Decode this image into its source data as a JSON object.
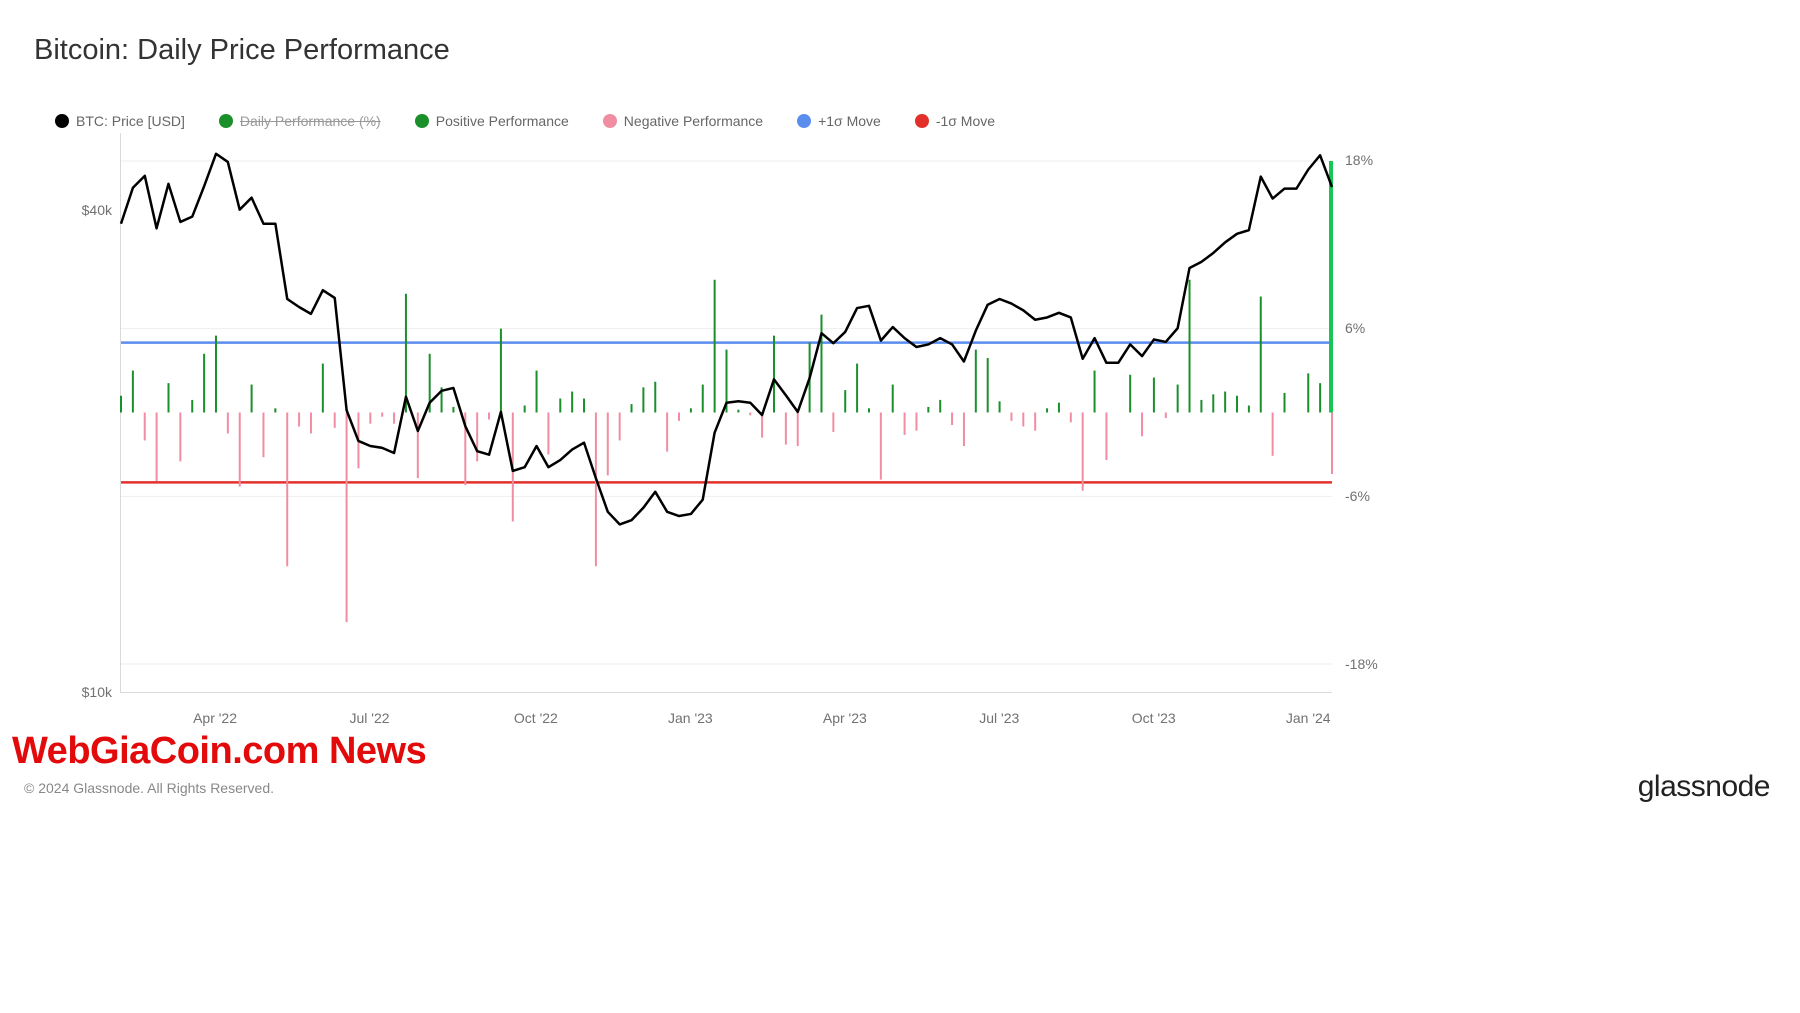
{
  "title": "Bitcoin: Daily Price Performance",
  "legend": [
    {
      "key": "price",
      "label": "BTC: Price [USD]",
      "color": "#000000",
      "hidden": false
    },
    {
      "key": "daily_pct",
      "label": "Daily Performance (%)",
      "color": "#1a8f2a",
      "hidden": true
    },
    {
      "key": "pos_perf",
      "label": "Positive Performance",
      "color": "#1a8f2a",
      "hidden": false
    },
    {
      "key": "neg_perf",
      "label": "Negative Performance",
      "color": "#f08da2",
      "hidden": false
    },
    {
      "key": "plus1s",
      "label": "+1σ Move",
      "color": "#5b8def",
      "hidden": false
    },
    {
      "key": "minus1s",
      "label": "-1σ Move",
      "color": "#e2302a",
      "hidden": false
    }
  ],
  "watermark": "WebGiaCoin.com News",
  "copyright": "© 2024 Glassnode. All Rights Reserved.",
  "brand": "glassnode",
  "chart_data": {
    "type": "line+bar",
    "title": "Bitcoin: Daily Price Performance",
    "x_ticks": [
      "Apr '22",
      "Jul '22",
      "Oct '22",
      "Jan '23",
      "Apr '23",
      "Jul '23",
      "Oct '23",
      "Jan '24"
    ],
    "y1": {
      "label": "",
      "ticks": [
        "$40k",
        "$10k"
      ],
      "scale": "log",
      "range": [
        10000,
        50000
      ]
    },
    "y2": {
      "label": "",
      "ticks": [
        "18%",
        "6%",
        "-6%",
        "-18%"
      ],
      "range": [
        -20,
        20
      ]
    },
    "sigma_plus": 5.0,
    "sigma_minus": -5.0,
    "dates": [
      "2022-02-01",
      "2022-02-08",
      "2022-02-15",
      "2022-02-22",
      "2022-03-01",
      "2022-03-08",
      "2022-03-15",
      "2022-03-22",
      "2022-03-29",
      "2022-04-05",
      "2022-04-12",
      "2022-04-19",
      "2022-04-26",
      "2022-05-03",
      "2022-05-10",
      "2022-05-17",
      "2022-05-24",
      "2022-05-31",
      "2022-06-07",
      "2022-06-14",
      "2022-06-21",
      "2022-06-28",
      "2022-07-05",
      "2022-07-12",
      "2022-07-19",
      "2022-07-26",
      "2022-08-02",
      "2022-08-09",
      "2022-08-16",
      "2022-08-23",
      "2022-08-30",
      "2022-09-06",
      "2022-09-13",
      "2022-09-20",
      "2022-09-27",
      "2022-10-04",
      "2022-10-11",
      "2022-10-18",
      "2022-10-25",
      "2022-11-01",
      "2022-11-08",
      "2022-11-15",
      "2022-11-22",
      "2022-11-29",
      "2022-12-06",
      "2022-12-13",
      "2022-12-20",
      "2022-12-27",
      "2023-01-03",
      "2023-01-10",
      "2023-01-17",
      "2023-01-24",
      "2023-01-31",
      "2023-02-07",
      "2023-02-14",
      "2023-02-21",
      "2023-02-28",
      "2023-03-07",
      "2023-03-14",
      "2023-03-21",
      "2023-03-28",
      "2023-04-04",
      "2023-04-11",
      "2023-04-18",
      "2023-04-25",
      "2023-05-02",
      "2023-05-09",
      "2023-05-16",
      "2023-05-23",
      "2023-05-30",
      "2023-06-06",
      "2023-06-13",
      "2023-06-20",
      "2023-06-27",
      "2023-07-04",
      "2023-07-11",
      "2023-07-18",
      "2023-07-25",
      "2023-08-01",
      "2023-08-08",
      "2023-08-15",
      "2023-08-22",
      "2023-08-29",
      "2023-09-05",
      "2023-09-12",
      "2023-09-19",
      "2023-09-26",
      "2023-10-03",
      "2023-10-10",
      "2023-10-17",
      "2023-10-24",
      "2023-10-31",
      "2023-11-07",
      "2023-11-14",
      "2023-11-21",
      "2023-11-28",
      "2023-12-05",
      "2023-12-12",
      "2023-12-19",
      "2023-12-26",
      "2024-01-02",
      "2024-01-09",
      "2024-01-12"
    ],
    "price_usd": [
      38500,
      42700,
      44200,
      38000,
      43200,
      38700,
      39300,
      42900,
      47100,
      46000,
      40100,
      41500,
      38500,
      38500,
      31000,
      30300,
      29700,
      31800,
      31100,
      22500,
      20600,
      20300,
      20200,
      19900,
      23400,
      21200,
      23000,
      23800,
      24000,
      21500,
      20000,
      19800,
      22400,
      18900,
      19100,
      20300,
      19100,
      19500,
      20100,
      20500,
      18500,
      16800,
      16200,
      16400,
      17000,
      17800,
      16800,
      16600,
      16700,
      17400,
      21100,
      23000,
      23100,
      23000,
      22200,
      24600,
      23500,
      22400,
      24700,
      28100,
      27300,
      28200,
      30200,
      30400,
      27500,
      28600,
      27700,
      27000,
      27200,
      27700,
      27200,
      25900,
      28300,
      30500,
      31000,
      30600,
      30000,
      29200,
      29400,
      29800,
      29400,
      26100,
      27700,
      25800,
      25800,
      27200,
      26300,
      27600,
      27400,
      28500,
      33900,
      34500,
      35400,
      36500,
      37400,
      37800,
      44100,
      41400,
      42600,
      42600,
      45000,
      46900,
      42800
    ],
    "daily_perf_pct": [
      1.2,
      3.0,
      -2.0,
      -4.9,
      2.1,
      -3.5,
      0.9,
      4.2,
      5.5,
      -1.5,
      -5.3,
      2.0,
      -3.2,
      0.3,
      -11.0,
      -1.0,
      -1.5,
      3.5,
      -1.1,
      -15.0,
      -4.0,
      -0.8,
      -0.3,
      -0.8,
      8.5,
      -4.7,
      4.2,
      1.8,
      0.4,
      -5.2,
      -3.5,
      -0.5,
      6.0,
      -7.8,
      0.5,
      3.0,
      -3.0,
      1.0,
      1.5,
      1.0,
      -11.0,
      -4.5,
      -2.0,
      0.6,
      1.8,
      2.2,
      -2.8,
      -0.6,
      0.3,
      2.0,
      9.5,
      4.5,
      0.2,
      -0.2,
      -1.8,
      5.5,
      -2.3,
      -2.4,
      5.0,
      7.0,
      -1.4,
      1.6,
      3.5,
      0.3,
      -4.8,
      2.0,
      -1.6,
      -1.3,
      0.4,
      0.9,
      -0.9,
      -2.4,
      4.5,
      3.9,
      0.8,
      -0.6,
      -1.0,
      -1.3,
      0.3,
      0.7,
      -0.7,
      -5.6,
      3.0,
      -3.4,
      0.0,
      2.7,
      -1.7,
      2.5,
      -0.4,
      2.0,
      9.5,
      0.9,
      1.3,
      1.5,
      1.2,
      0.5,
      8.3,
      -3.1,
      1.4,
      0.0,
      2.8,
      2.1,
      -4.4
    ],
    "last_bar_pct": 18.0
  }
}
